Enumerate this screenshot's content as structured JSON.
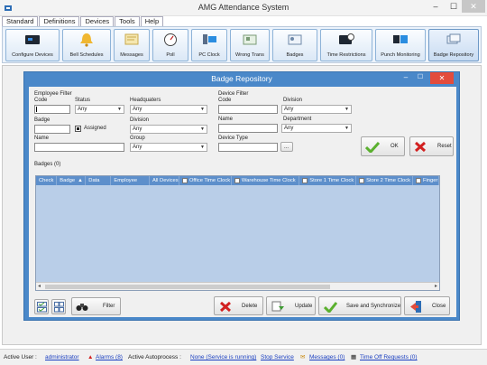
{
  "window": {
    "title": "AMG Attendance System",
    "minimize": "–",
    "maximize": "☐",
    "close": "✕"
  },
  "menu": [
    "Standard",
    "Definitions",
    "Devices",
    "Tools",
    "Help"
  ],
  "toolbar": [
    {
      "label": "Configure Devices",
      "icon": "device-icon"
    },
    {
      "label": "Bell Schedules",
      "icon": "bell-icon"
    },
    {
      "label": "Messages",
      "icon": "message-icon"
    },
    {
      "label": "Poll",
      "icon": "gauge-icon"
    },
    {
      "label": "PC Clock",
      "icon": "pc-clock-icon"
    },
    {
      "label": "Wrong Trans",
      "icon": "card-icon"
    },
    {
      "label": "Badges",
      "icon": "badge-icon"
    },
    {
      "label": "Time Restrictions",
      "icon": "clock-device-icon"
    },
    {
      "label": "Punch Monitoring",
      "icon": "monitor-icon"
    },
    {
      "label": "Badge Repository",
      "icon": "repository-icon"
    }
  ],
  "dialog": {
    "title": "Badge Repository",
    "employee_filter": {
      "heading": "Employee Filter",
      "code_label": "Code",
      "code_value": "",
      "status_label": "Status",
      "status_value": "Any",
      "headquarters_label": "Headquaters",
      "headquarters_value": "Any",
      "badge_label": "Badge",
      "badge_value": "",
      "assigned_label": "Assigned",
      "division_label": "Division",
      "division_value": "Any",
      "name_label": "Name",
      "name_value": "",
      "group_label": "Group",
      "group_value": "Any"
    },
    "device_filter": {
      "heading": "Device Filter",
      "code_label": "Code",
      "code_value": "",
      "division_label": "Division",
      "division_value": "Any",
      "name_label": "Name",
      "name_value": "",
      "department_label": "Department",
      "department_value": "Any",
      "device_type_label": "Device Type",
      "device_type_value": "",
      "browse_label": "..."
    },
    "ok_label": "OK",
    "reset_label": "Reset",
    "badges_caption": "Badges (0)",
    "grid_columns": [
      "Check",
      "Badge",
      "Data",
      "Employee",
      "All Devices",
      "Office Time Clock",
      "Warehouse Time Clock",
      "Store 1 Time Clock",
      "Store 2 Time Clock",
      "Finger"
    ],
    "filter_label": "Filter",
    "delete_label": "Delete",
    "update_label": "Update",
    "save_sync_label": "Save and Synchronize",
    "close_label": "Close"
  },
  "status": {
    "active_user_label": "Active User :",
    "active_user": "administrator",
    "alarms": "Alarms (8)",
    "autoprocess_label": "Active Autoprocess :",
    "autoprocess_value": "None (Service is running)",
    "stop_service": "Stop Service",
    "messages": "Messages (0)",
    "time_off": "Time Off Requests (0)"
  },
  "colors": {
    "dialog_title": "#4a88c9",
    "grid_header": "#5d8fcb",
    "grid_body": "#b9cee8",
    "link": "#1a3fc1",
    "close_red": "#e34c3c"
  }
}
